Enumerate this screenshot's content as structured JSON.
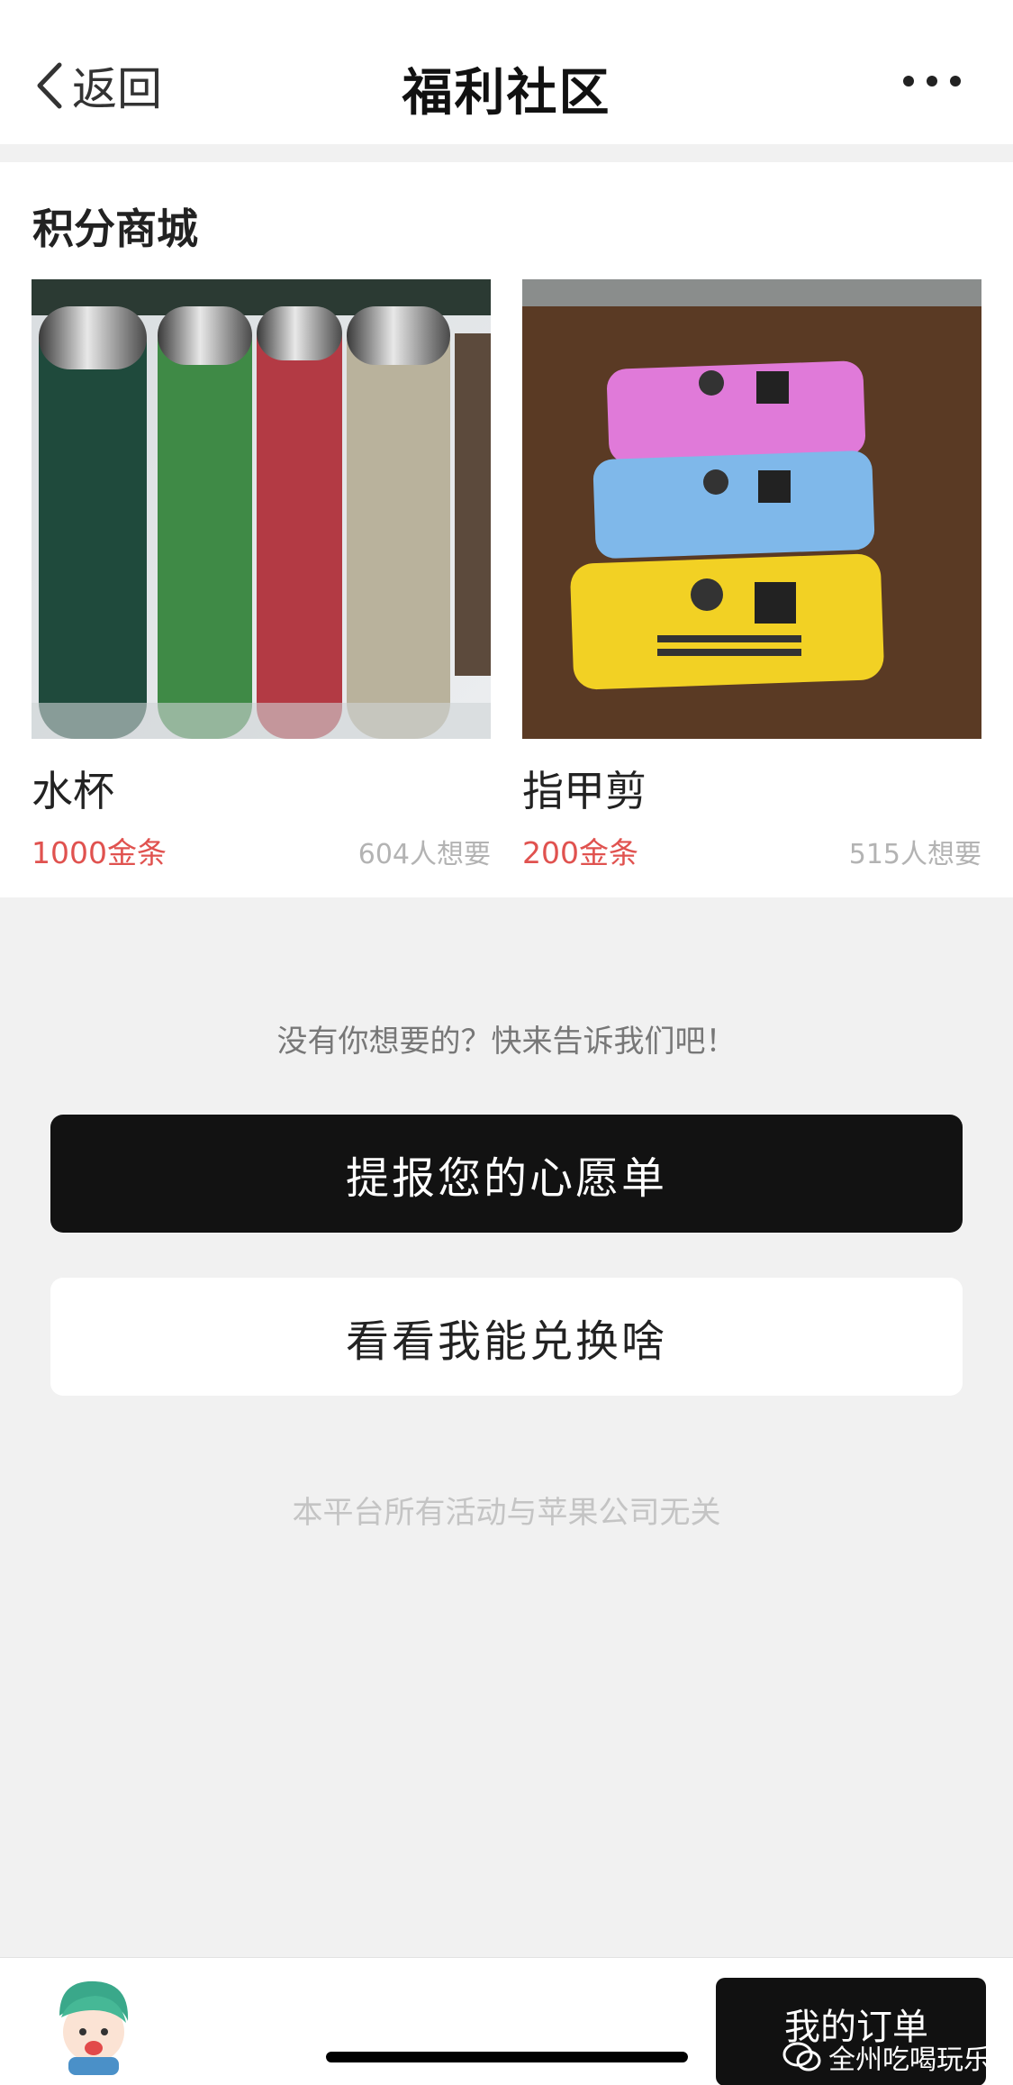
{
  "nav": {
    "back_label": "返回",
    "title": "福利社区",
    "more_icon": "more-dots-icon"
  },
  "shop": {
    "section_title": "积分商城",
    "products": [
      {
        "name": "水杯",
        "price": "1000金条",
        "wants": "604人想要",
        "image": "thermos-bottles"
      },
      {
        "name": "指甲剪",
        "price": "200金条",
        "wants": "515人想要",
        "image": "nail-clipper-cases"
      }
    ]
  },
  "wishlist": {
    "prompt": "没有你想要的？快来告诉我们吧！",
    "primary_button": "提报您的心愿单",
    "secondary_button": "看看我能兑换啥"
  },
  "disclaimer": "本平台所有活动与苹果公司无关",
  "bottom": {
    "orders_button": "我的订单",
    "watermark_text": "全州吃喝玩乐"
  },
  "colors": {
    "price": "#e0524f",
    "primary_button_bg": "#121212",
    "page_bg": "#f1f1f1"
  }
}
